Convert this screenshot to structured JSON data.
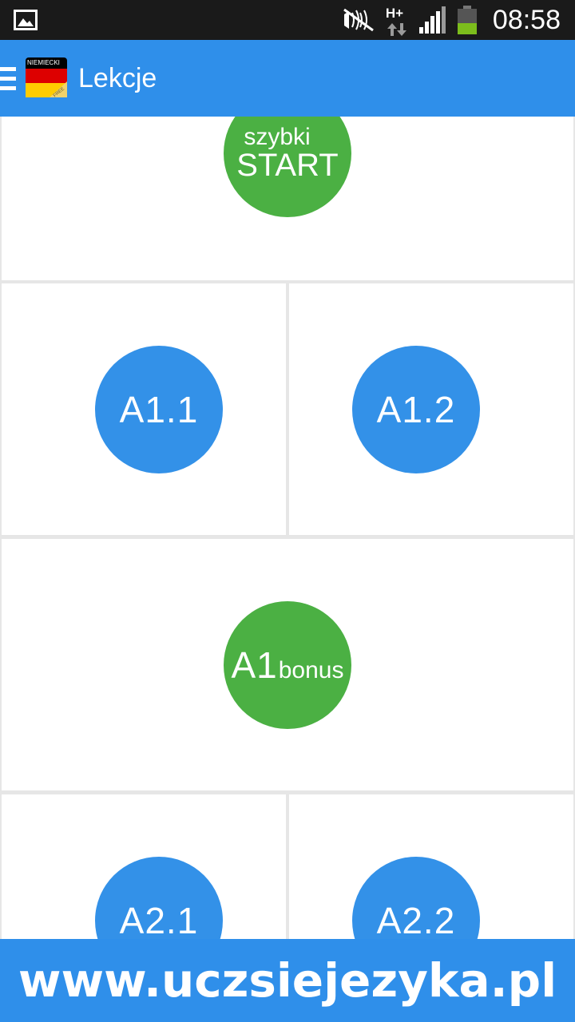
{
  "status_bar": {
    "time": "08:58",
    "network_label": "H+",
    "icons": [
      "gallery-icon",
      "mute-icon",
      "hplus-data-icon",
      "signal-icon",
      "battery-icon"
    ]
  },
  "action_bar": {
    "title": "Lekcje",
    "logo_text": "NIEMIECKI",
    "logo_badge": "FREE",
    "menu_icon": "menu-icon",
    "colors": {
      "background": "#2f8fea"
    }
  },
  "lessons": {
    "quick_start": {
      "line1": "szybki",
      "line2": "START"
    },
    "a1_1": "A1.1",
    "a1_2": "A1.2",
    "a1_bonus": {
      "main": "A1",
      "suffix": "bonus"
    },
    "a2_1": "A2.1",
    "a2_2": "A2.2",
    "colors": {
      "green": "#4bb043",
      "blue": "#3391e8"
    }
  },
  "banner": {
    "text": "www.uczsiejezyka.pl"
  }
}
